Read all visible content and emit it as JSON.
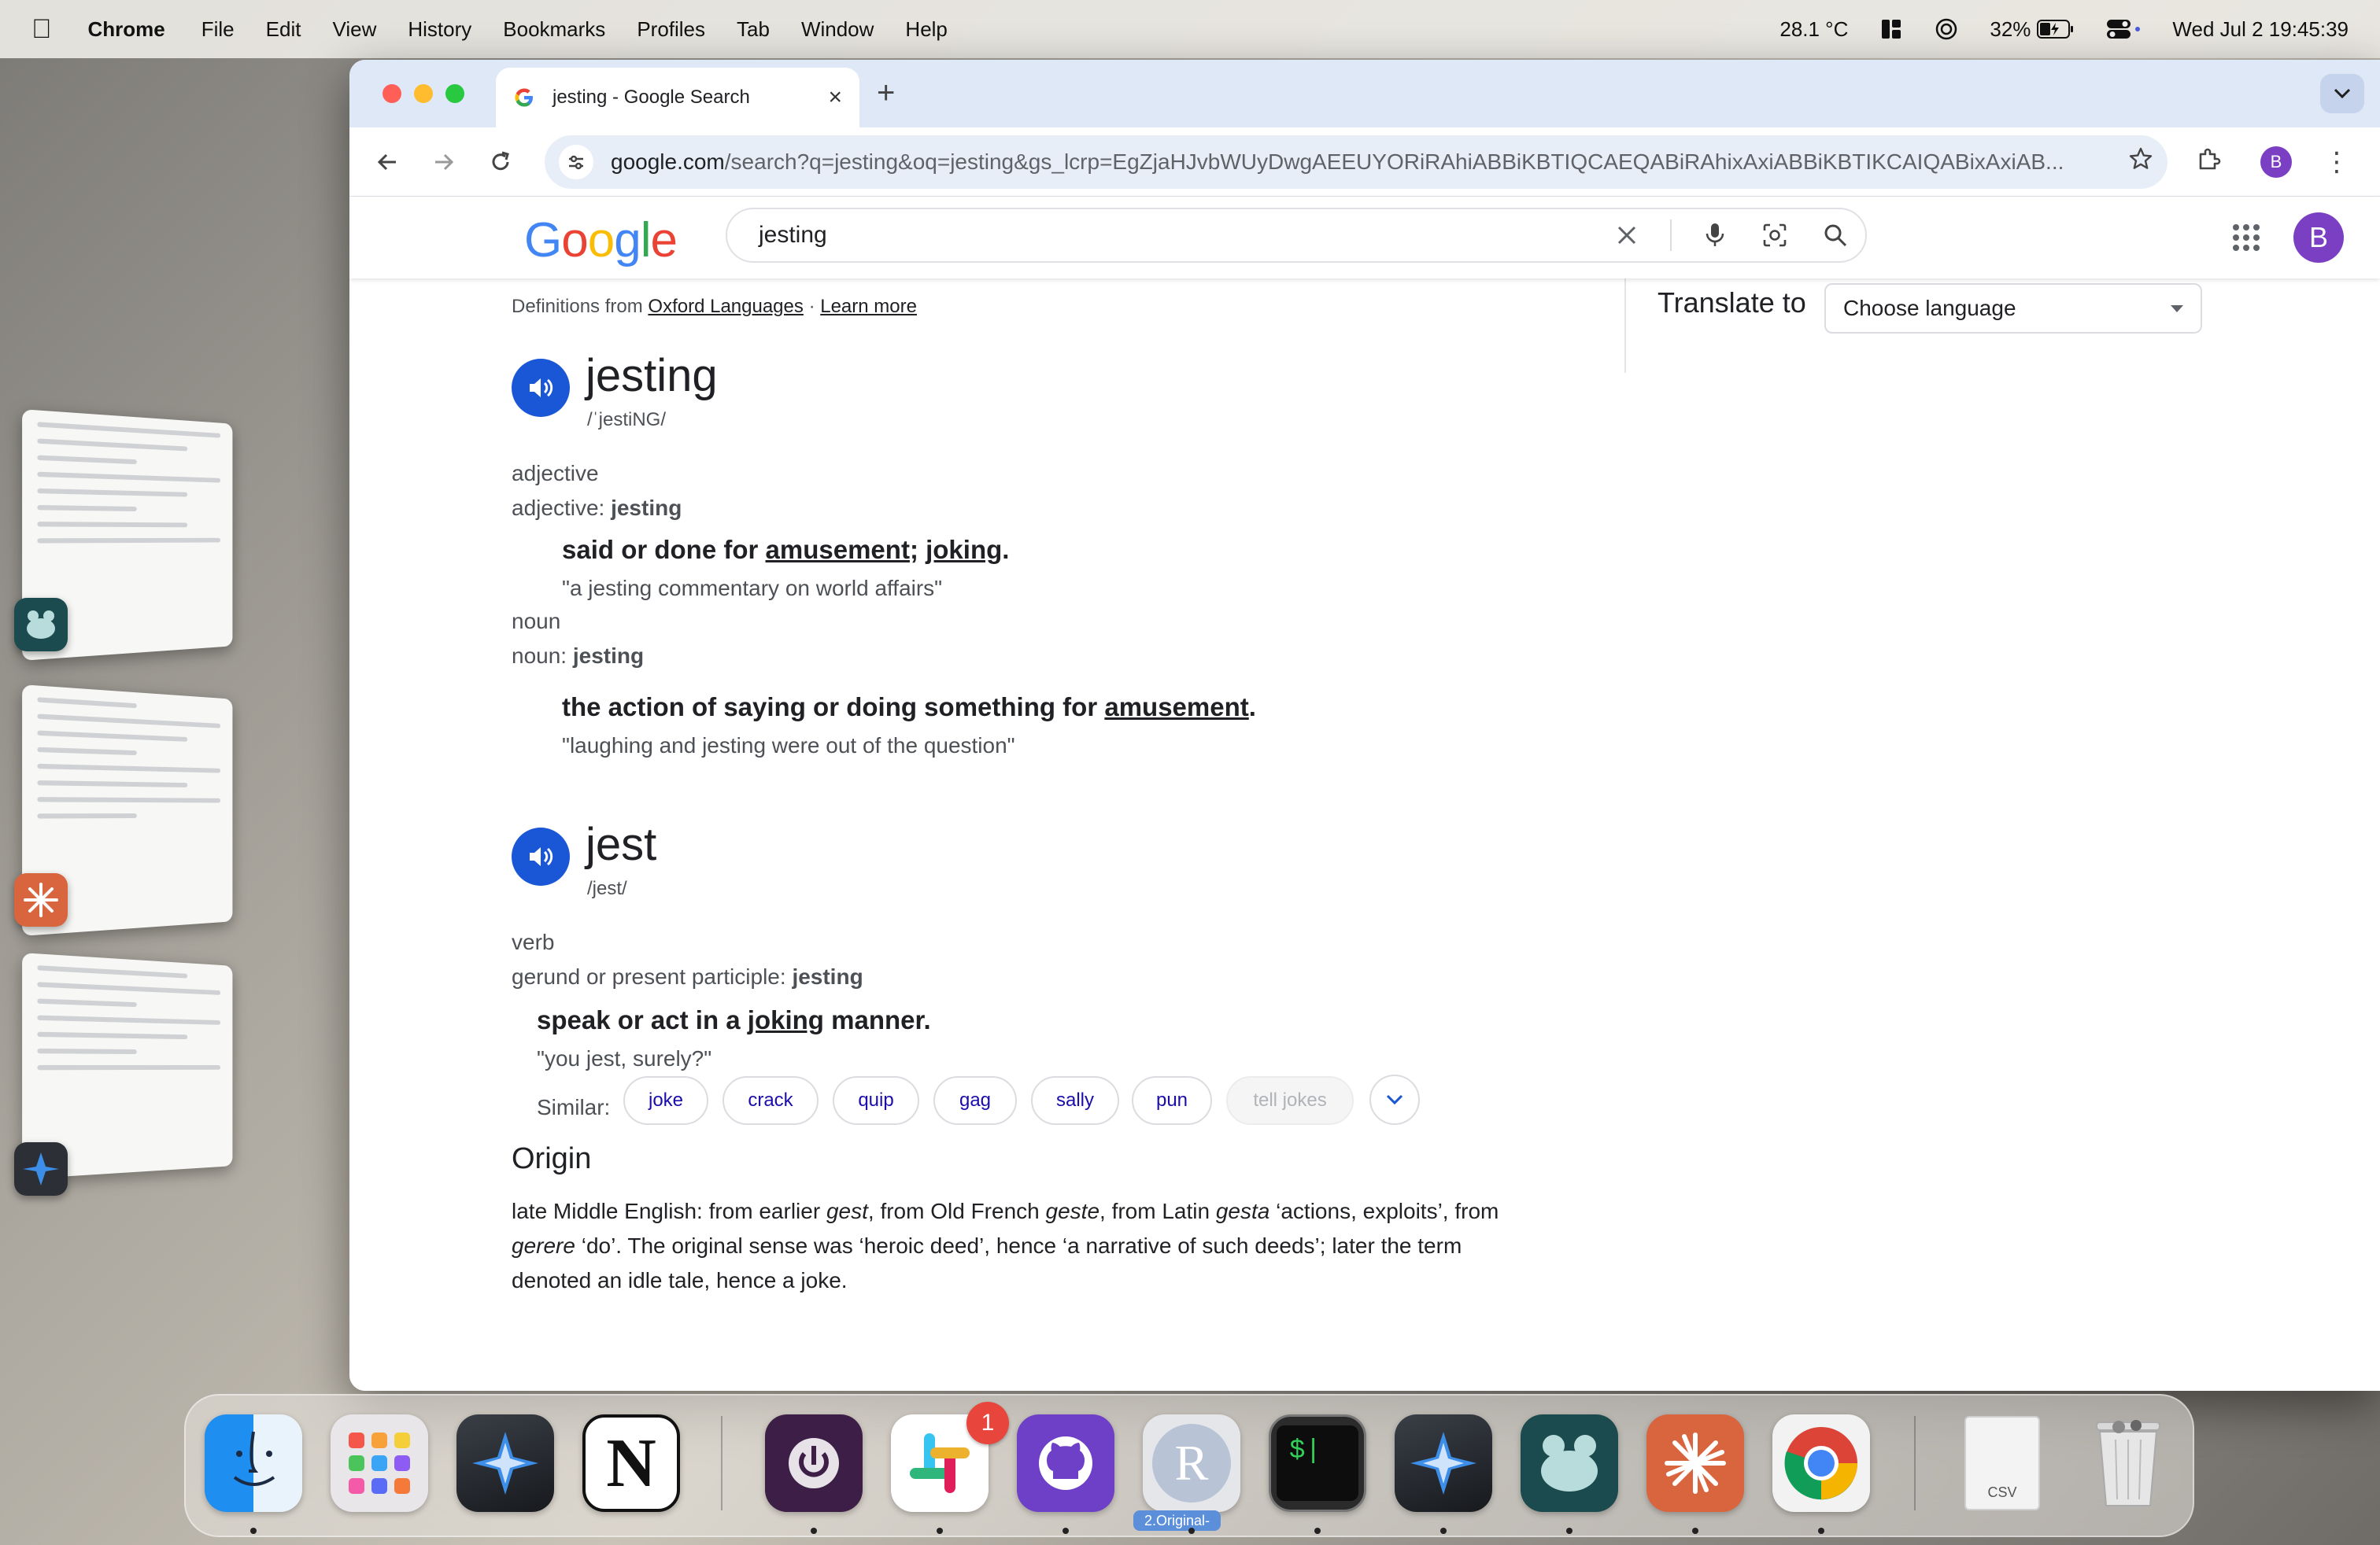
{
  "menubar": {
    "app_name": "Chrome",
    "menus": [
      "File",
      "Edit",
      "View",
      "History",
      "Bookmarks",
      "Profiles",
      "Tab",
      "Window",
      "Help"
    ],
    "temperature": "28.1 °C",
    "battery": "32%",
    "datetime": "Wed Jul 2  19:45:39"
  },
  "browser": {
    "tab_title": "jesting - Google Search",
    "url_host": "google.com",
    "url_path": "/search?q=jesting&oq=jesting&gs_lcrp=EgZjaHJvbWUyDwgAEEUYORiRAhiABBiKBTIQCAEQABiRAhixAxiABBiKBTIKCAIQABixAxiAB...",
    "profile_initial": "B"
  },
  "google": {
    "logo": "Google",
    "query": "jesting",
    "profile_initial": "B",
    "colors": {
      "blue": "#4285F4",
      "red": "#EA4335",
      "yellow": "#FBBC05",
      "green": "#34A853"
    }
  },
  "dictionary": {
    "source_prefix": "Definitions from",
    "source_link": "Oxford Languages",
    "separator": "·",
    "learn_more": "Learn more",
    "translate_label": "Translate to",
    "translate_select": "Choose language",
    "entry1": {
      "word": "jesting",
      "phonetic": "/ˈjestiNG/",
      "pos1": "adjective",
      "inflect1_prefix": "adjective:",
      "inflect1_word": "jesting",
      "sense1_a": "said or done for ",
      "sense1_link1": "amusement",
      "sense1_b": "; ",
      "sense1_link2": "joking",
      "sense1_c": ".",
      "example1": "\"a jesting commentary on world affairs\"",
      "pos2": "noun",
      "inflect2_prefix": "noun:",
      "inflect2_word": "jesting",
      "sense2_a": "the action of saying or doing something for ",
      "sense2_link": "amusement",
      "sense2_c": ".",
      "example2": "\"laughing and jesting were out of the question\""
    },
    "entry2": {
      "word": "jest",
      "phonetic": "/jest/",
      "pos": "verb",
      "inflect_prefix": "gerund or present participle:",
      "inflect_word": "jesting",
      "sense_a": "speak or act in a ",
      "sense_link": "joking",
      "sense_c": " manner.",
      "example": "\"you jest, surely?\"",
      "similar_label": "Similar:",
      "similar": [
        "joke",
        "crack",
        "quip",
        "gag",
        "sally",
        "pun",
        "tell jokes"
      ]
    },
    "origin": {
      "heading": "Origin",
      "t1": "late Middle English: from earlier ",
      "i1": "gest",
      "t2": ", from Old French ",
      "i2": "geste",
      "t3": ", from Latin ",
      "i3": "gesta",
      "t4": " ‘actions, exploits’, from ",
      "i4": "gerere",
      "t5": " ‘do’. The original sense was ‘heroic deed’, hence ‘a narrative of such deeds’; later the term denoted an idle tale, hence a joke."
    }
  },
  "dock": {
    "apps": [
      "Finder",
      "Launchpad",
      "Spark",
      "Notion",
      "Power",
      "Slack",
      "GitHub Desktop",
      "R",
      "Terminal",
      "Spark",
      "Loom",
      "Claude",
      "Chrome",
      "CSV",
      "Trash"
    ],
    "slack_badge": "1",
    "r_caption": "2.Original-",
    "csv_label": "CSV",
    "notion_letter": "N",
    "r_letter": "R",
    "terminal_text": "$|"
  }
}
